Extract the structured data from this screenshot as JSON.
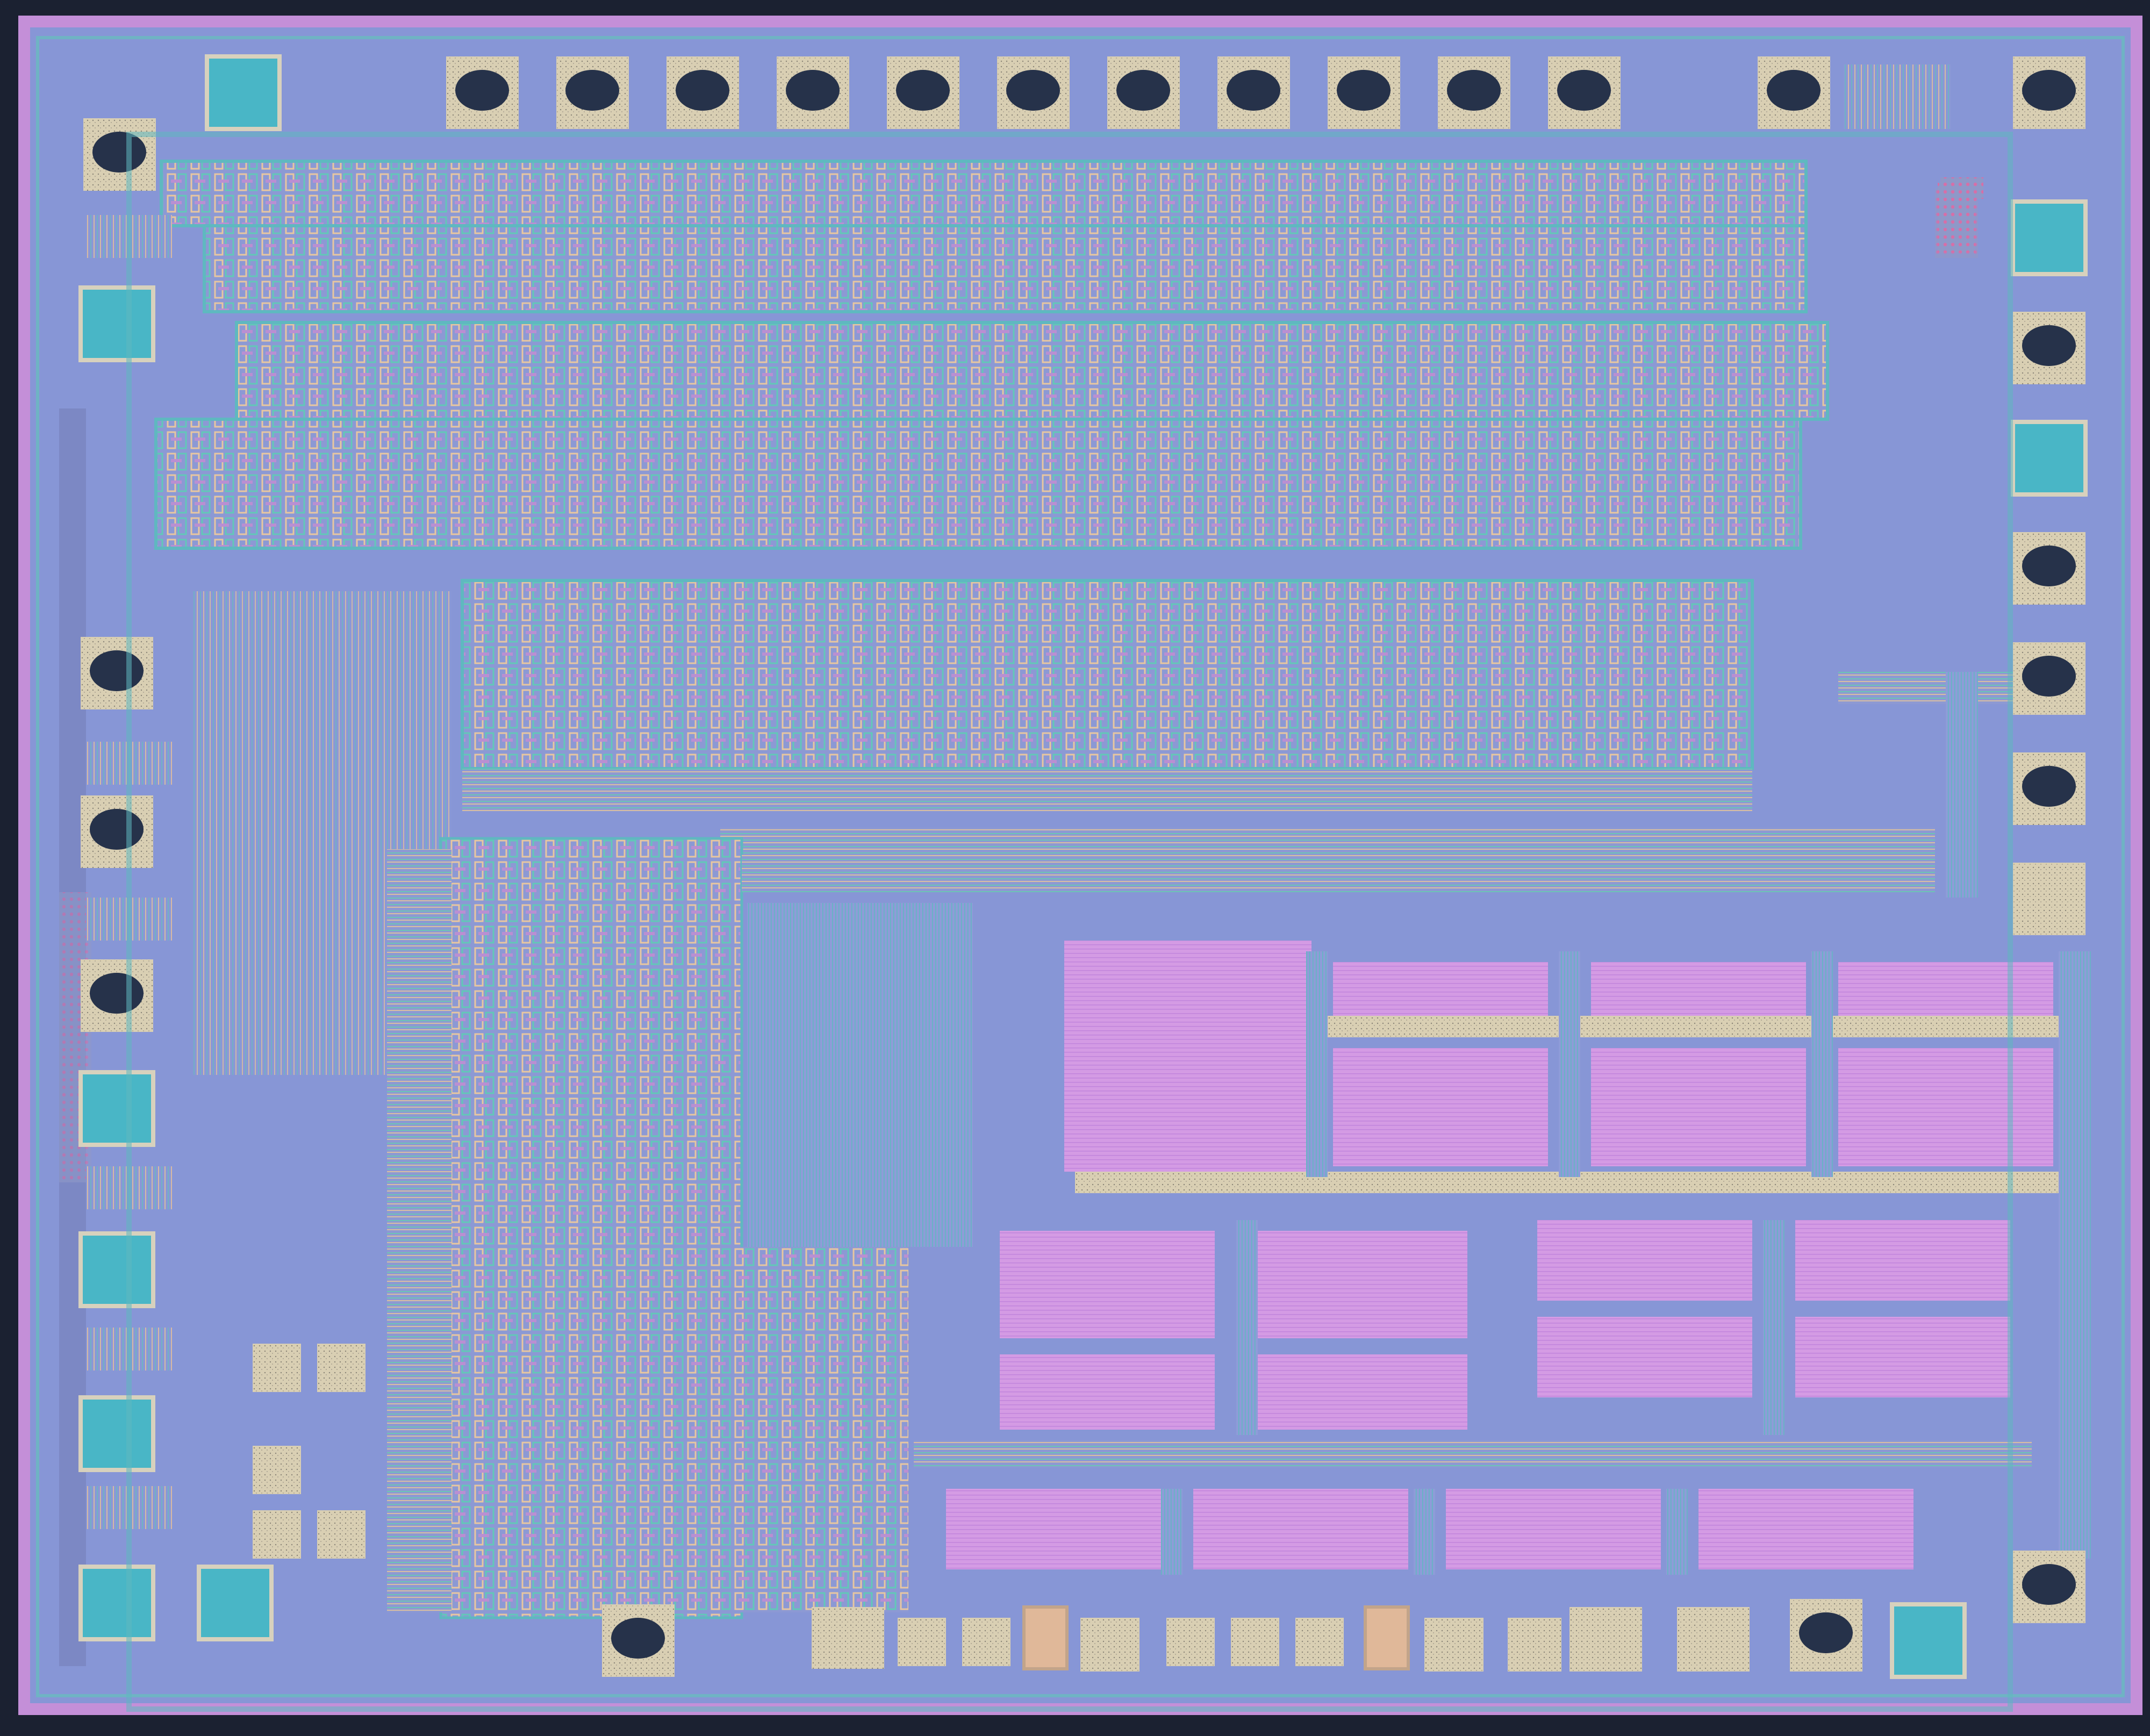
{
  "image": {
    "subject": "die-photo",
    "colors": {
      "background": "#1b2131",
      "die_substrate": "#8796d6",
      "seal_ring": "#c48fd8",
      "metal_trace": "#62c8b8",
      "poly_trace": "#e6c9a0",
      "capacitor": "#d79ae6",
      "pad_metal": "#d8d0b8",
      "bond_wire_blob": "#26324a",
      "esd_pad": "#49b6c6"
    },
    "top_pads": {
      "count": 12,
      "bonded": 12
    },
    "left_pads": {
      "count": 11
    },
    "right_pads": {
      "count": 11
    },
    "bottom_pads": {
      "count": 15
    },
    "capacitor_array": {
      "rows": 3,
      "blocks": 14
    },
    "logic_rows": 4
  }
}
